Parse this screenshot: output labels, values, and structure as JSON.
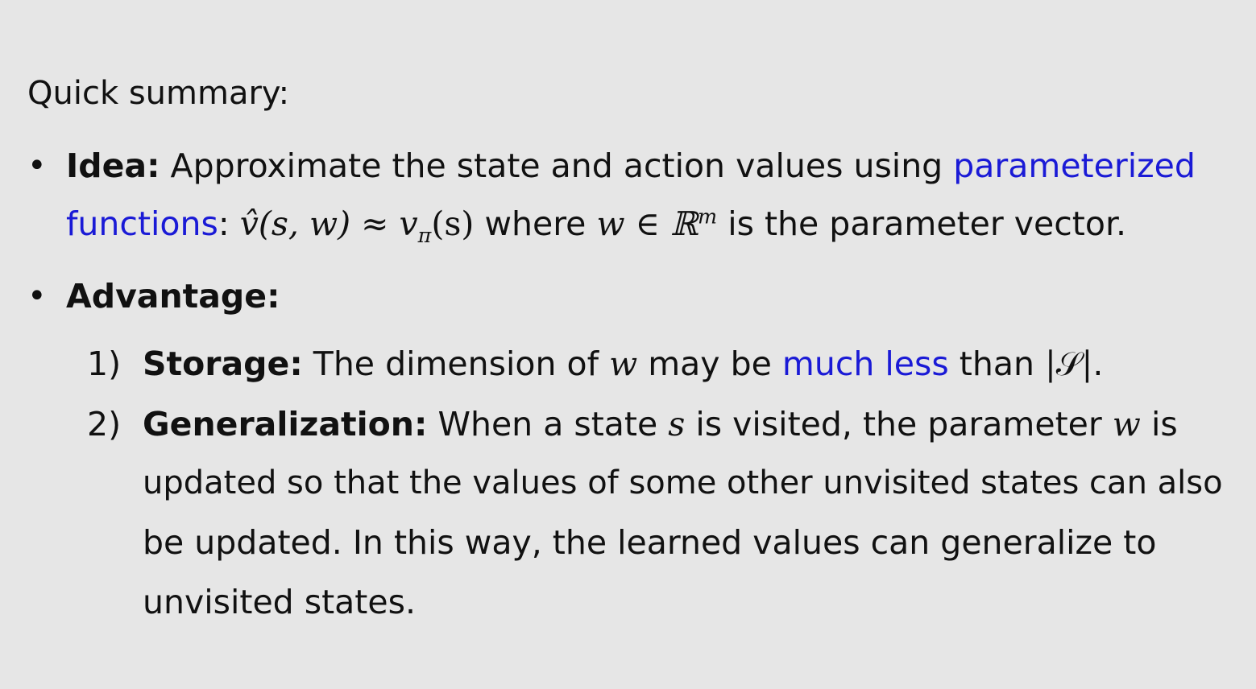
{
  "heading": "Quick summary:",
  "idea": {
    "term": "Idea:",
    "text_a": "Approximate the state and action values using",
    "highlight_a": "parameterized",
    "highlight_b": "functions",
    "text_b": ":",
    "math_vhat": "v̂(s, w) ≈ v",
    "math_pi": "π",
    "math_s": "(s)",
    "text_c": "where",
    "math_w": "w ∈ ℝ",
    "math_m": "m",
    "text_d": "is the parameter vector."
  },
  "advantage": {
    "term": "Advantage:",
    "items": [
      {
        "number": "1)",
        "term": "Storage:",
        "text_a": "The dimension of",
        "math_w": "w",
        "text_b": "may be",
        "highlight": "much less",
        "text_c": "than",
        "math_s": "|𝒮|",
        "text_d": "."
      },
      {
        "number": "2)",
        "term": "Generalization:",
        "text_a": "When a state",
        "math_s": "s",
        "text_b": "is visited, the parameter",
        "math_w": "w",
        "text_c": "is",
        "line2": "updated so that the values of some other unvisited states can also",
        "line3": "be updated. In this way, the learned values can generalize to",
        "line4": "unvisited states."
      }
    ]
  }
}
